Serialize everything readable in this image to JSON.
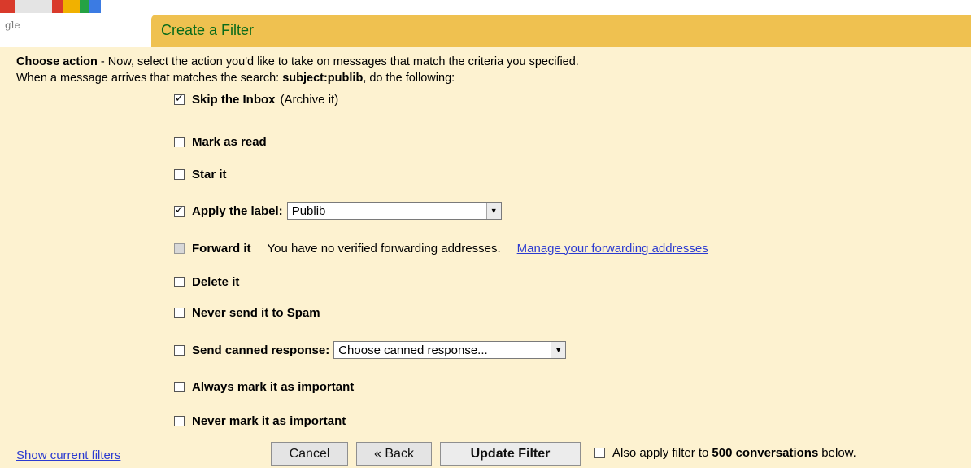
{
  "logo": {
    "subtext": "gle"
  },
  "header": {
    "title": "Create a Filter"
  },
  "intro": {
    "line1_bold": "Choose action",
    "line1_rest": " - Now, select the action you'd like to take on messages that match the criteria you specified.",
    "line2_prefix": "When a message arrives that matches the search: ",
    "line2_query": "subject:publib",
    "line2_suffix": ", do the following:"
  },
  "actions": {
    "skip_inbox": {
      "label": "Skip the Inbox",
      "note": "(Archive it)",
      "checked": true
    },
    "mark_read": {
      "label": "Mark as read",
      "checked": false
    },
    "star": {
      "label": "Star it",
      "checked": false
    },
    "apply_label": {
      "label": "Apply the label:",
      "checked": true,
      "value": "Publib"
    },
    "forward": {
      "label": "Forward it",
      "note": "You have no verified forwarding addresses.",
      "link": "Manage your forwarding addresses",
      "enabled": false
    },
    "delete": {
      "label": "Delete it",
      "checked": false
    },
    "never_spam": {
      "label": "Never send it to Spam",
      "checked": false
    },
    "canned": {
      "label": "Send canned response:",
      "checked": false,
      "placeholder": "Choose canned response..."
    },
    "always_important": {
      "label": "Always mark it as important",
      "checked": false
    },
    "never_important": {
      "label": "Never mark it as important",
      "checked": false
    }
  },
  "footer": {
    "show_filters": "Show current filters",
    "cancel": "Cancel",
    "back": "« Back",
    "update": "Update Filter",
    "also_prefix": "Also apply filter to",
    "also_count": "500 conversations",
    "also_suffix": "below."
  },
  "colors": {
    "titlebar": "#efc150",
    "panel": "#fdf2d0",
    "title_text": "#0a6b1a",
    "link": "#2c3bd0"
  }
}
